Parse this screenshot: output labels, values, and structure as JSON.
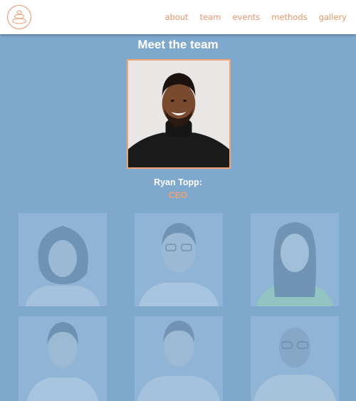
{
  "nav": {
    "logo_icon": "stacked-stones-logo-icon",
    "links": [
      "about",
      "team",
      "events",
      "methods",
      "gallery"
    ]
  },
  "main": {
    "title": "Meet the team",
    "featured": {
      "name": "Ryan Topp:",
      "role": "CEO"
    }
  },
  "colors": {
    "background": "#7fa8cd",
    "accent": "#e8956a",
    "nav_background": "#ffffff",
    "title_text": "#ffffff"
  }
}
